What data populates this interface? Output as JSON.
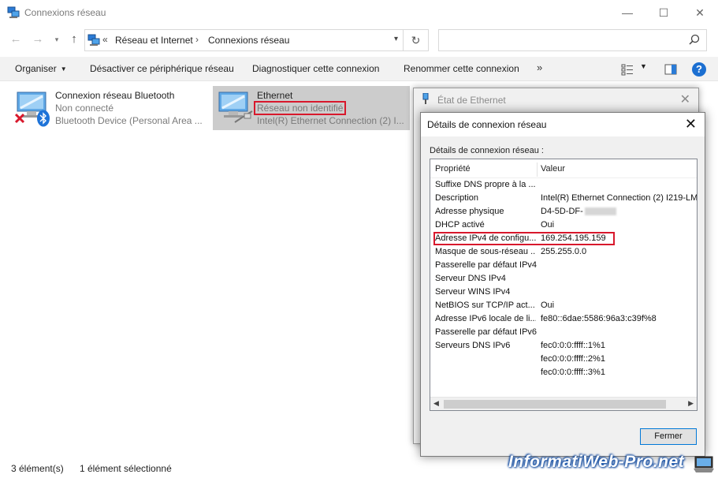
{
  "window": {
    "title": "Connexions réseau",
    "controls": {
      "minimize": "—",
      "maximize": "☐",
      "close": "✕"
    }
  },
  "address": {
    "prefix": "«",
    "crumbs": [
      "Réseau et Internet",
      "Connexions réseau"
    ],
    "separator": "›",
    "search_placeholder": ""
  },
  "commands": {
    "organize": "Organiser",
    "disable": "Désactiver ce périphérique réseau",
    "diagnose": "Diagnostiquer cette connexion",
    "rename": "Renommer cette connexion",
    "more": "»"
  },
  "connections": [
    {
      "name": "Connexion réseau Bluetooth",
      "status": "Non connecté",
      "device": "Bluetooth Device (Personal Area ...",
      "selected": false
    },
    {
      "name": "Ethernet",
      "status": "Réseau non identifié",
      "device": "Intel(R) Ethernet Connection (2) I...",
      "selected": true
    }
  ],
  "statusbar": {
    "count": "3 élément(s)",
    "selection": "1 élément sélectionné"
  },
  "status_dialog": {
    "title": "État de Ethernet",
    "close": "✕"
  },
  "details_dialog": {
    "title": "Détails de connexion réseau",
    "close": "✕",
    "label": "Détails de connexion réseau :",
    "col_property": "Propriété",
    "col_value": "Valeur",
    "rows": [
      {
        "k": "Suffixe DNS propre à la ...",
        "v": ""
      },
      {
        "k": "Description",
        "v": "Intel(R) Ethernet Connection (2) I219-LM"
      },
      {
        "k": "Adresse physique",
        "v": "D4-5D-DF-"
      },
      {
        "k": "DHCP activé",
        "v": "Oui"
      },
      {
        "k": "Adresse IPv4 de configu...",
        "v": "169.254.195.159"
      },
      {
        "k": "Masque de sous-réseau ...",
        "v": "255.255.0.0"
      },
      {
        "k": "Passerelle par défaut IPv4",
        "v": ""
      },
      {
        "k": "Serveur DNS IPv4",
        "v": ""
      },
      {
        "k": "Serveur WINS IPv4",
        "v": ""
      },
      {
        "k": "NetBIOS sur TCP/IP act...",
        "v": "Oui"
      },
      {
        "k": "Adresse IPv6 locale de li...",
        "v": "fe80::6dae:5586:96a3:c39f%8"
      },
      {
        "k": "Passerelle par défaut IPv6",
        "v": ""
      },
      {
        "k": "Serveurs DNS IPv6",
        "v": "fec0:0:0:ffff::1%1"
      },
      {
        "k": "",
        "v": "fec0:0:0:ffff::2%1"
      },
      {
        "k": "",
        "v": "fec0:0:0:ffff::3%1"
      }
    ],
    "close_button": "Fermer"
  },
  "watermark": "InformatiWeb-Pro.net",
  "colors": {
    "highlight_red": "#d8182c",
    "selected_bg": "#cccccc",
    "accent": "#0078d7"
  }
}
